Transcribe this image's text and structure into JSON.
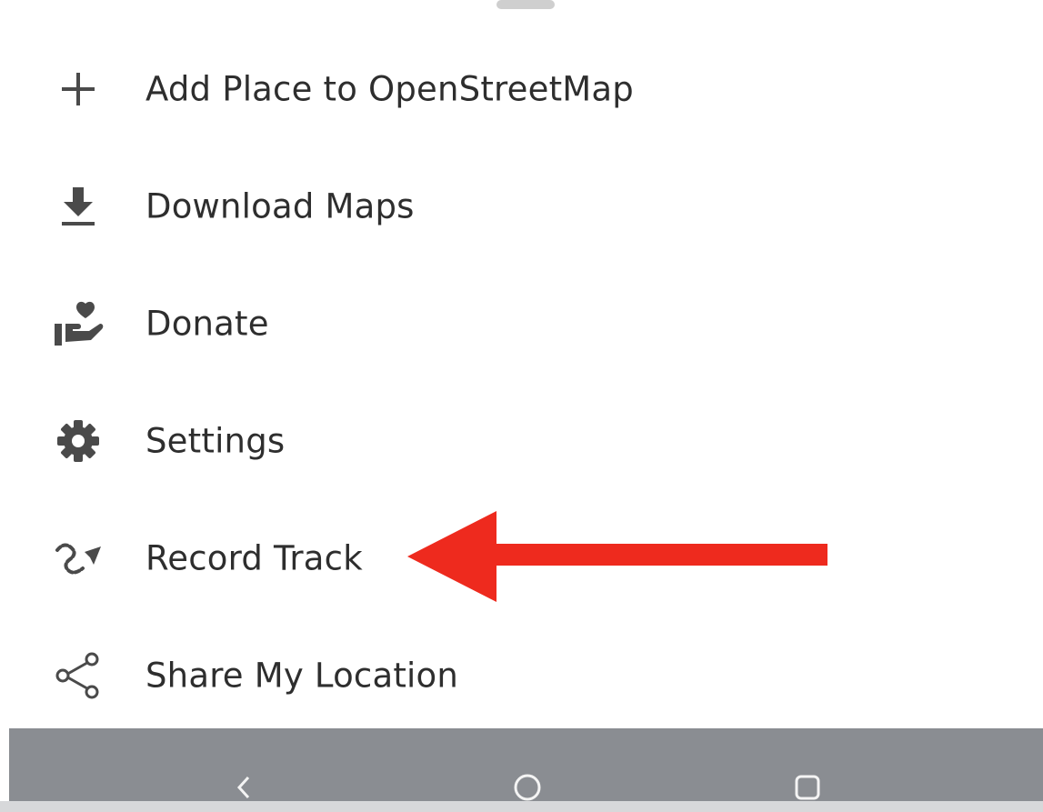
{
  "menu": {
    "items": [
      {
        "label": "Add Place to OpenStreetMap",
        "icon": "plus-icon"
      },
      {
        "label": "Download Maps",
        "icon": "download-icon"
      },
      {
        "label": "Donate",
        "icon": "donate-icon"
      },
      {
        "label": "Settings",
        "icon": "gear-icon"
      },
      {
        "label": "Record Track",
        "icon": "record-track-icon"
      },
      {
        "label": "Share My Location",
        "icon": "share-icon"
      }
    ]
  },
  "annotation": {
    "type": "arrow",
    "color": "#ee2a1e",
    "points_to": "Record Track"
  },
  "nav_bar": {
    "buttons": [
      "back-icon",
      "home-icon",
      "recents-icon"
    ],
    "background": "#8a8d92"
  },
  "colors": {
    "text": "#2e2e2e",
    "icon": "#4a4a4a",
    "background": "#ffffff"
  }
}
